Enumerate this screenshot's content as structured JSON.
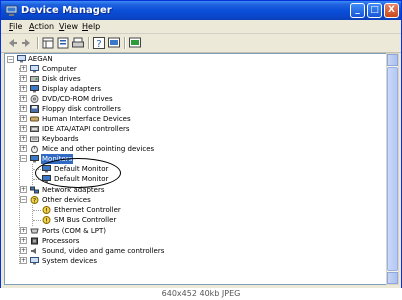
{
  "window": {
    "title": "Device Manager",
    "controls": {
      "minimize": "_",
      "maximize": "□",
      "close": "X"
    }
  },
  "menu": [
    {
      "accel": "F",
      "rest": "ile"
    },
    {
      "accel": "A",
      "rest": "ction"
    },
    {
      "accel": "V",
      "rest": "iew"
    },
    {
      "accel": "H",
      "rest": "elp"
    }
  ],
  "toolbar": [
    "back-icon",
    "forward-icon",
    "view-icon",
    "properties-icon",
    "print-icon",
    "help-icon",
    "refresh-icon",
    "scan-icon"
  ],
  "tree": {
    "root": "AEGAN",
    "items": [
      {
        "label": "Computer",
        "icon": "computer-icon",
        "expanded": false
      },
      {
        "label": "Disk drives",
        "icon": "disk-icon",
        "expanded": false
      },
      {
        "label": "Display adapters",
        "icon": "display-icon",
        "expanded": false
      },
      {
        "label": "DVD/CD-ROM drives",
        "icon": "cdrom-icon",
        "expanded": false
      },
      {
        "label": "Floppy disk controllers",
        "icon": "floppy-icon",
        "expanded": false
      },
      {
        "label": "Human Interface Devices",
        "icon": "hid-icon",
        "expanded": false
      },
      {
        "label": "IDE ATA/ATAPI controllers",
        "icon": "ide-icon",
        "expanded": false
      },
      {
        "label": "Keyboards",
        "icon": "keyboard-icon",
        "expanded": false
      },
      {
        "label": "Mice and other pointing devices",
        "icon": "mouse-icon",
        "expanded": false
      },
      {
        "label": "Monitors",
        "icon": "monitor-icon",
        "expanded": true,
        "selected": true,
        "children": [
          {
            "label": "Default Monitor"
          },
          {
            "label": "Default Monitor"
          }
        ]
      },
      {
        "label": "Network adapters",
        "icon": "network-icon",
        "expanded": false
      },
      {
        "label": "Other devices",
        "icon": "other-devices-icon",
        "expanded": true,
        "children": [
          {
            "label": "Ethernet Controller"
          },
          {
            "label": "SM Bus Controller"
          }
        ]
      },
      {
        "label": "Ports (COM & LPT)",
        "icon": "port-icon",
        "expanded": false
      },
      {
        "label": "Processors",
        "icon": "processor-icon",
        "expanded": false
      },
      {
        "label": "Sound, video and game controllers",
        "icon": "sound-icon",
        "expanded": false
      },
      {
        "label": "System devices",
        "icon": "system-icon",
        "expanded": false
      }
    ]
  },
  "caption": "640x452 40kb JPEG"
}
